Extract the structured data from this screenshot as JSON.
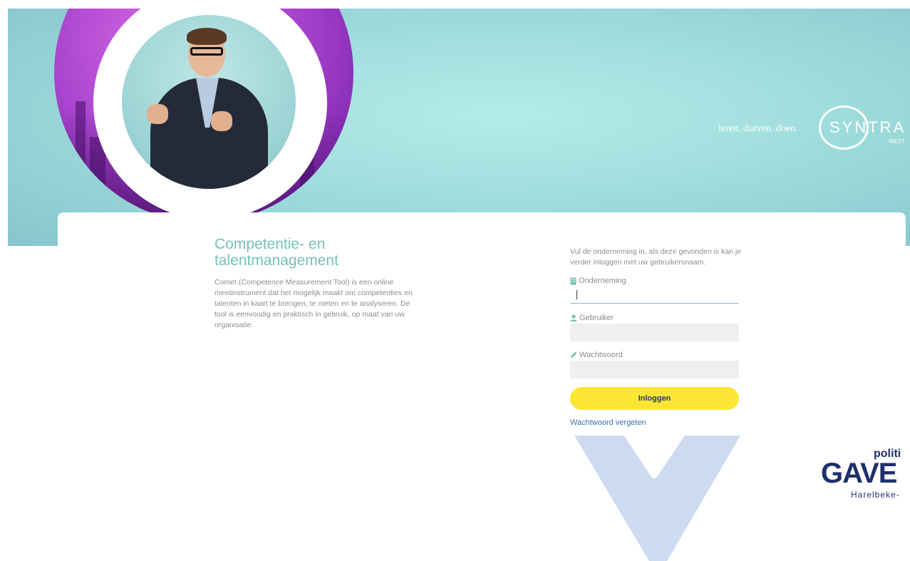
{
  "banner": {
    "tagline": "leren. durven. doen.",
    "logo": {
      "name": "SYNTRA",
      "sub": "WEST"
    }
  },
  "intro_section": {
    "title": "Competentie- en talentmanagement",
    "description": "Comet (Competence Measurement Tool) is een online meetinstrument dat het mogelijk maakt om competenties en talenten in kaart te brengen, te meten en te analyseren. De tool is eenvoudig en praktisch in gebruik, op maat van uw organisatie."
  },
  "login": {
    "instruction": "Vul de onderneming in, als deze gevonden is kan je verder inloggen met uw gebruikersnaam.",
    "company_label": "Onderneming",
    "company_icon": "building-icon",
    "company_value": "",
    "user_label": "Gebruiker",
    "user_icon": "user-icon",
    "user_value": "",
    "password_label": "Wachtwoord",
    "password_icon": "pencil-icon",
    "password_value": "",
    "submit_label": "Inloggen",
    "forgot_label": "Wachtwoord vergeten"
  },
  "sponsor": {
    "line1": "politi",
    "line2": "GAVE",
    "line3": "Harelbeke-"
  },
  "colors": {
    "accent_teal": "#74c2b4",
    "button_yellow": "#fce634",
    "link_blue": "#356fae",
    "banner_teal": "#a2dfde",
    "brand_navy": "#1f2f6b"
  }
}
